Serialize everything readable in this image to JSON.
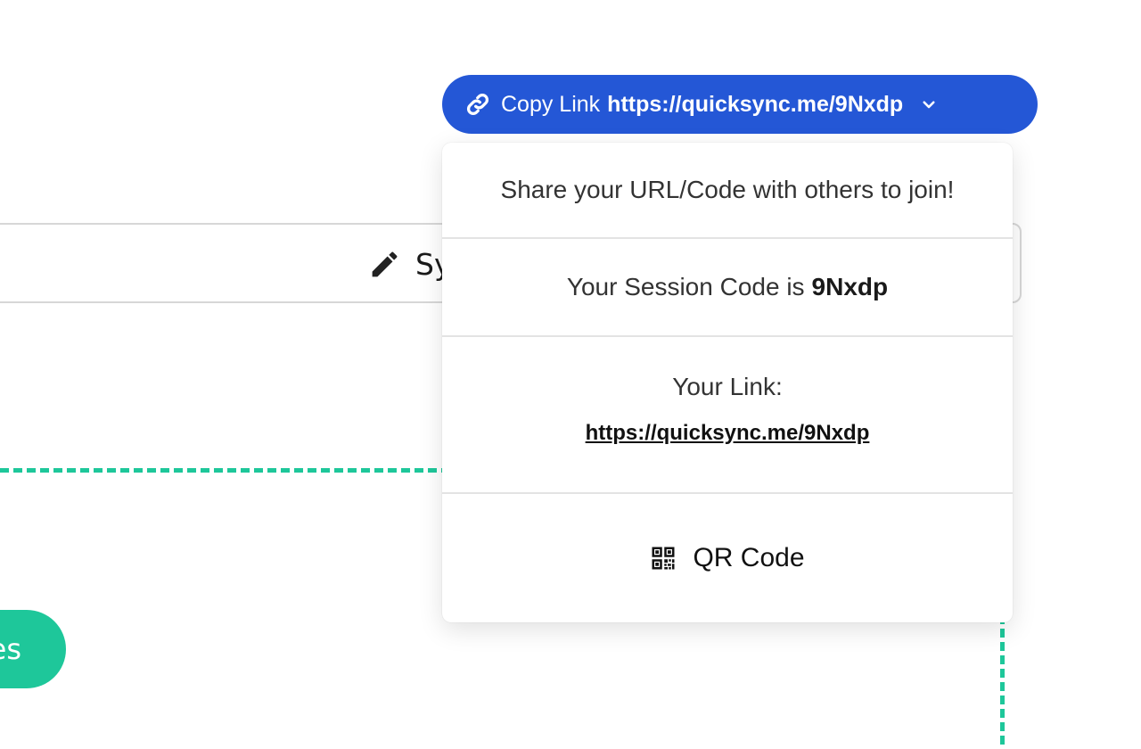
{
  "background": {
    "edit_bar_label": "Sy",
    "green_button_label": "es"
  },
  "copy_link": {
    "label": "Copy Link",
    "url": "https://quicksync.me/9Nxdp",
    "icons": {
      "link": "link-icon",
      "toggle": "chevron-down-icon"
    },
    "color": "#2457d6"
  },
  "dropdown": {
    "header": "Share your URL/Code with others to join!",
    "session_prefix": "Your Session Code is",
    "session_code": "9Nxdp",
    "link_label": "Your Link:",
    "link_url": "https://quicksync.me/9Nxdp",
    "qr_label": "QR Code",
    "qr_icon": "qrcode-icon"
  },
  "accent_green": "#1ec79a"
}
